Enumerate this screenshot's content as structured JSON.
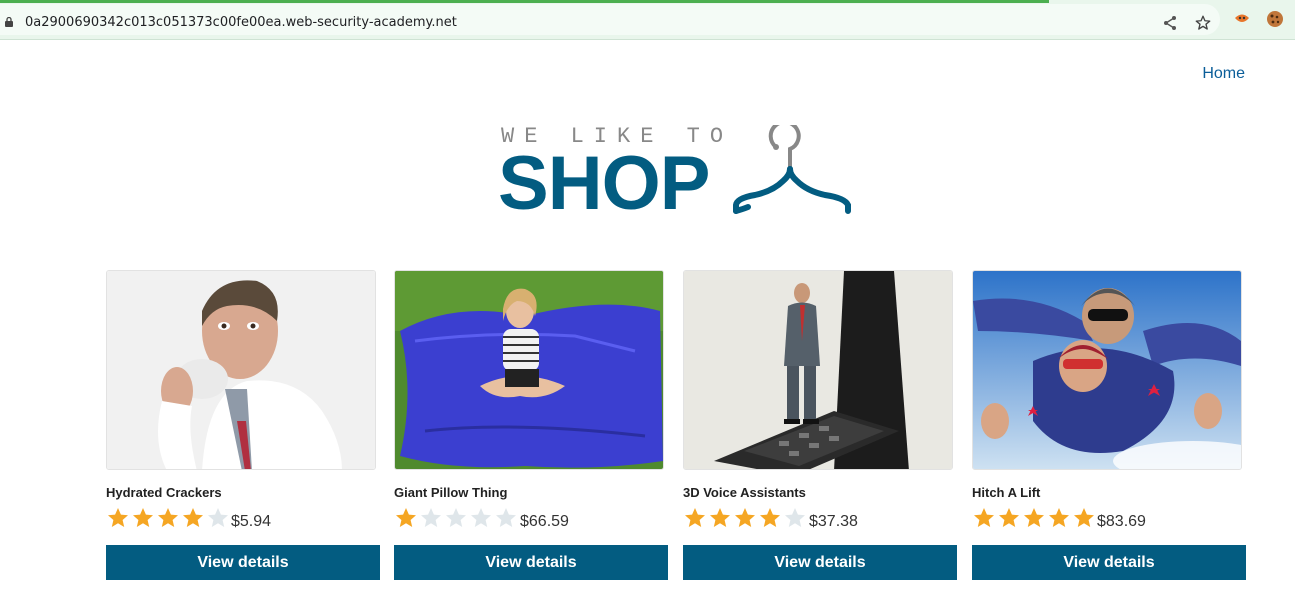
{
  "browser": {
    "url": "0a2900690342c013c051373c00fe00ea.web-security-academy.net",
    "progress": 0.81
  },
  "header": {
    "home_label": "Home"
  },
  "logo": {
    "small_text": "WE LIKE TO",
    "big_text": "SHOP",
    "colors": {
      "primary": "#035c81",
      "secondary": "#888888"
    }
  },
  "products": [
    {
      "name": "Hydrated Crackers",
      "rating": 4,
      "price": "$5.94",
      "button_label": "View details"
    },
    {
      "name": "Giant Pillow Thing",
      "rating": 1,
      "price": "$66.59",
      "button_label": "View details"
    },
    {
      "name": "3D Voice Assistants",
      "rating": 4,
      "price": "$37.38",
      "button_label": "View details"
    },
    {
      "name": "Hitch A Lift",
      "rating": 5,
      "price": "$83.69",
      "button_label": "View details"
    }
  ],
  "colors": {
    "accent": "#035c81",
    "star_filled": "#f5a623",
    "star_empty": "#dfe6ea",
    "link": "#0b5e99"
  }
}
